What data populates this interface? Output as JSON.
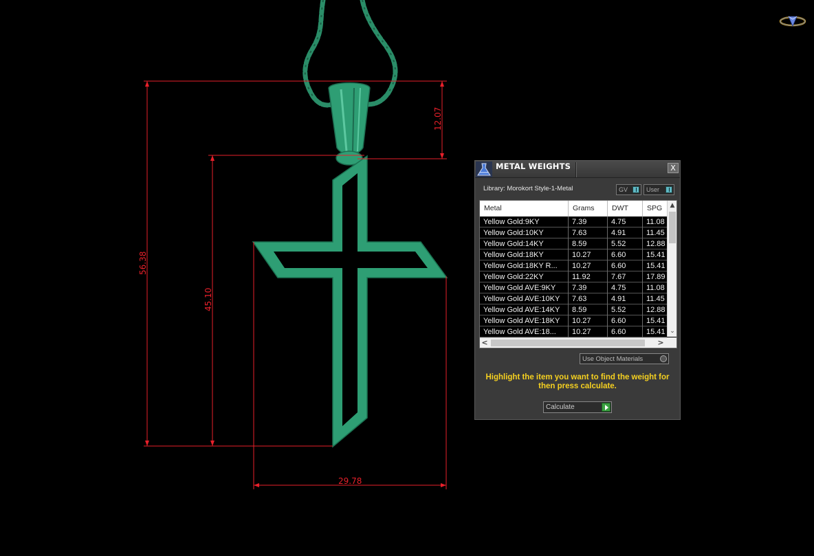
{
  "colors": {
    "background": "#000000",
    "model": "#2e9e74",
    "dimension": "#e8202a",
    "hint": "#f5d020",
    "panel": "#3a3a3a"
  },
  "dimensions": {
    "overall_height": "56.38",
    "cross_height": "45.10",
    "bail_height": "12.07",
    "width": "29.78"
  },
  "panel": {
    "title": "METAL WEIGHTS",
    "close_label": "X",
    "library_label": "Library: Morokort Style-1-Metal",
    "toggle_gv": "GV",
    "toggle_user": "User",
    "columns": [
      "Metal",
      "Grams",
      "DWT",
      "SPG"
    ],
    "rows": [
      [
        "Yellow Gold:9KY",
        "7.39",
        "4.75",
        "11.08"
      ],
      [
        "Yellow Gold:10KY",
        "7.63",
        "4.91",
        "11.45"
      ],
      [
        "Yellow Gold:14KY",
        "8.59",
        "5.52",
        "12.88"
      ],
      [
        "Yellow Gold:18KY",
        "10.27",
        "6.60",
        "15.41"
      ],
      [
        "Yellow Gold:18KY R...",
        "10.27",
        "6.60",
        "15.41"
      ],
      [
        "Yellow Gold:22KY",
        "11.92",
        "7.67",
        "17.89"
      ],
      [
        "Yellow Gold AVE:9KY",
        "7.39",
        "4.75",
        "11.08"
      ],
      [
        "Yellow Gold AVE:10KY",
        "7.63",
        "4.91",
        "11.45"
      ],
      [
        "Yellow Gold AVE:14KY",
        "8.59",
        "5.52",
        "12.88"
      ],
      [
        "Yellow Gold AVE:18KY",
        "10.27",
        "6.60",
        "15.41"
      ],
      [
        "Yellow Gold AVE:18...",
        "10.27",
        "6.60",
        "15.41"
      ]
    ],
    "use_object_materials": "Use Object Materials",
    "hint": "Highlight the item you want to find the weight for then press calculate.",
    "calculate_label": "Calculate"
  }
}
